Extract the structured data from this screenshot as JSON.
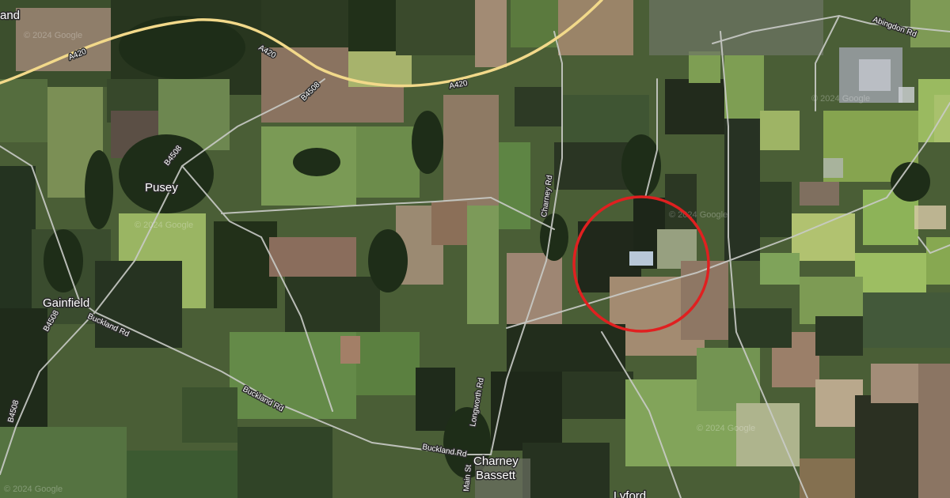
{
  "map": {
    "type": "satellite",
    "places": {
      "pusey": "Pusey",
      "gainfield": "Gainfield",
      "charney_line1": "Charney",
      "charney_line2": "Bassett",
      "lyford": "Lyford",
      "partial_left": "and"
    },
    "roads": {
      "a420_west": "A420",
      "a420_mid": "A420",
      "a420_east": "A420",
      "b4508_north": "B4508",
      "b4508_pusey": "B4508",
      "b4508_gainfield": "B4508",
      "b4508_south": "B4508",
      "abingdon_rd": "Abingdon Rd",
      "charney_rd": "Charney Rd",
      "buckland_rd_west": "Buckland Rd",
      "buckland_rd_mid": "Buckland Rd",
      "buckland_rd_south": "Buckland Rd",
      "longworth_rd": "Longworth Rd",
      "main_st": "Main St"
    },
    "watermarks": [
      "© 2024 Google",
      "© 2024 Google",
      "© 2024 Google",
      "© 2024 Google",
      "© 2024 Google",
      "© 2024 Google"
    ],
    "highlight": {
      "shape": "circle",
      "color": "#e02020"
    },
    "colors": {
      "major_road": "#f2d98a",
      "minor_road": "#c9cbc7",
      "field_dark": "#28331f",
      "field_mid": "#4a5e36",
      "field_light": "#7e9656",
      "field_brown": "#8a7560"
    }
  }
}
